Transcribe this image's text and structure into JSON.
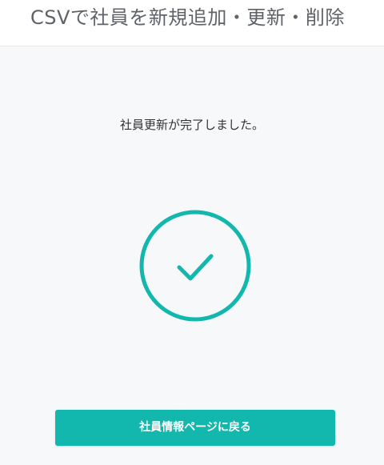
{
  "header": {
    "title": "CSVで社員を新規追加・更新・削除"
  },
  "main": {
    "message": "社員更新が完了しました。",
    "status_icon": "check-circle-icon",
    "back_button_label": "社員情報ページに戻る"
  },
  "colors": {
    "accent": "#12b7ad",
    "background": "#f7f8fa",
    "header_text": "#5f6368"
  }
}
